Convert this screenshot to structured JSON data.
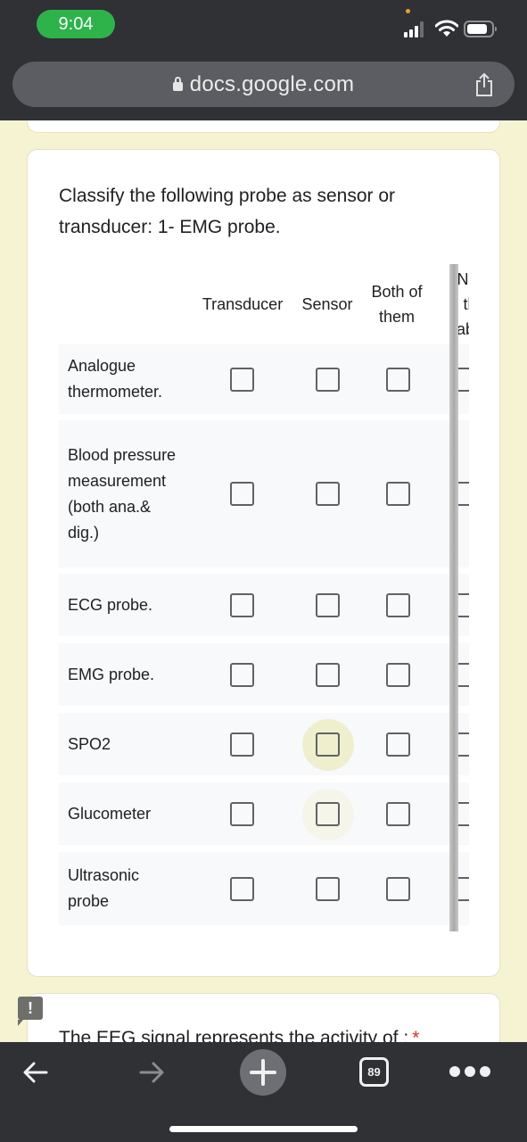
{
  "status_bar": {
    "time": "9:04",
    "signal_icon": "cellular-signal-icon",
    "wifi_icon": "wifi-icon",
    "battery_icon": "battery-icon"
  },
  "browser": {
    "url": "docs.google.com",
    "lock_icon": "lock-icon",
    "share_icon": "share-icon",
    "toolbar": {
      "back_icon": "arrow-left-icon",
      "forward_icon": "arrow-right-icon",
      "new_tab_icon": "plus-icon",
      "tab_count": "89",
      "more_icon": "ellipsis-icon"
    }
  },
  "form": {
    "question": {
      "title": "Classify the following probe as sensor or transducer: 1- EMG probe.",
      "columns": [
        "Transducer",
        "Sensor",
        "Both of them",
        "None of the above"
      ],
      "column_headers_visible": [
        "Transducer",
        "Sensor",
        "Both of\nthem",
        "Nor\nth\nabo"
      ],
      "rows": [
        {
          "label": "Analogue thermometer.",
          "checked": [
            false,
            false,
            false,
            false
          ]
        },
        {
          "label": "Blood pressure measurement (both ana.& dig.)",
          "checked": [
            false,
            false,
            false,
            false
          ]
        },
        {
          "label": "ECG probe.",
          "checked": [
            false,
            false,
            false,
            false
          ]
        },
        {
          "label": "EMG probe.",
          "checked": [
            false,
            false,
            false,
            false
          ]
        },
        {
          "label": "SPO2",
          "checked": [
            false,
            false,
            false,
            false
          ]
        },
        {
          "label": "Glucometer",
          "checked": [
            false,
            false,
            false,
            false
          ]
        },
        {
          "label": "Ultrasonic probe",
          "checked": [
            false,
            false,
            false,
            false
          ]
        }
      ]
    },
    "next_question": {
      "title": "The EEG signal represents the activity of :",
      "required_marker": "*",
      "alert_icon": "exclamation-icon",
      "alert_text": "!"
    }
  },
  "colors": {
    "page_bg": "#f5f3d2",
    "chrome_bg": "#2f3135",
    "time_pill": "#2db34a",
    "required": "#d93025"
  }
}
